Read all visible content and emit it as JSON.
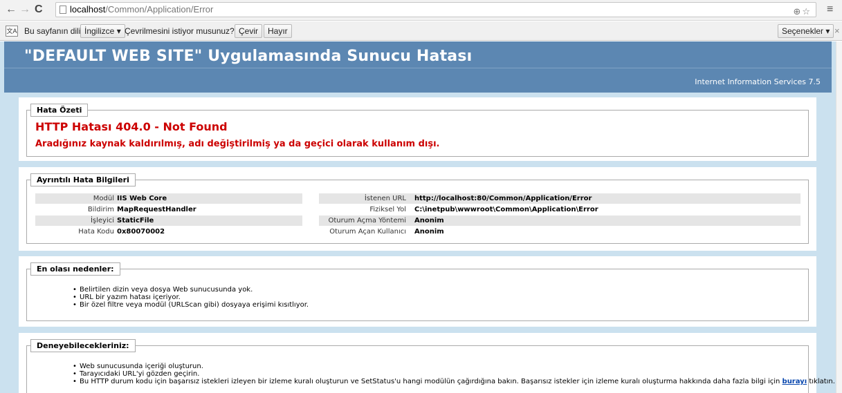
{
  "browser": {
    "url_host": "localhost",
    "url_path": "/Common/Application/Error",
    "omnibox_icons": "⊕☆"
  },
  "translate_bar": {
    "prefix": "Bu sayfanın dili",
    "language_select": "İngilizce ▾",
    "question": "Çevrilmesini istiyor musunuz?",
    "translate_label": "Çevir",
    "no_label": "Hayır",
    "options_label": "Seçenekler ▾",
    "translate_icon_text": "文A"
  },
  "header": {
    "title": "\"DEFAULT WEB SITE\" Uygulamasında Sunucu Hatası",
    "subtitle": "Internet Information Services 7.5"
  },
  "summary": {
    "legend": "Hata Özeti",
    "title": "HTTP Hatası 404.0 - Not Found",
    "message": "Aradığınız kaynak kaldırılmış, adı değiştirilmiş ya da geçici olarak kullanım dışı."
  },
  "details": {
    "legend": "Ayrıntılı Hata Bilgileri",
    "left": [
      {
        "label": "Modül",
        "value": "IIS Web Core"
      },
      {
        "label": "Bildirim",
        "value": "MapRequestHandler"
      },
      {
        "label": "İşleyici",
        "value": "StaticFile"
      },
      {
        "label": "Hata Kodu",
        "value": "0x80070002"
      }
    ],
    "right": [
      {
        "label": "İstenen URL",
        "value": "http://localhost:80/Common/Application/Error"
      },
      {
        "label": "Fiziksel Yol",
        "value": "C:\\inetpub\\wwwroot\\Common\\Application\\Error"
      },
      {
        "label": "Oturum Açma Yöntemi",
        "value": "Anonim"
      },
      {
        "label": "Oturum Açan Kullanıcı",
        "value": "Anonim"
      }
    ]
  },
  "causes": {
    "legend": "En olası nedenler:",
    "items": [
      "Belirtilen dizin veya dosya Web sunucusunda yok.",
      "URL bir yazım hatası içeriyor.",
      "Bir özel filtre veya modül (URLScan gibi) dosyaya erişimi kısıtlıyor."
    ]
  },
  "tries": {
    "legend": "Deneyebilecekleriniz:",
    "items": [
      "Web sunucusunda içeriği oluşturun.",
      "Tarayıcıdaki URL'yi gözden geçirin."
    ],
    "last_item_text": "Bu HTTP durum kodu için başarısız istekleri izleyen bir izleme kuralı oluşturun ve SetStatus'u hangi modülün çağırdığına bakın. Başarısız istekler için izleme kuralı oluşturma hakkında daha fazla bilgi için",
    "link_label": "burayı",
    "last_item_suffix": "tıklatın."
  }
}
